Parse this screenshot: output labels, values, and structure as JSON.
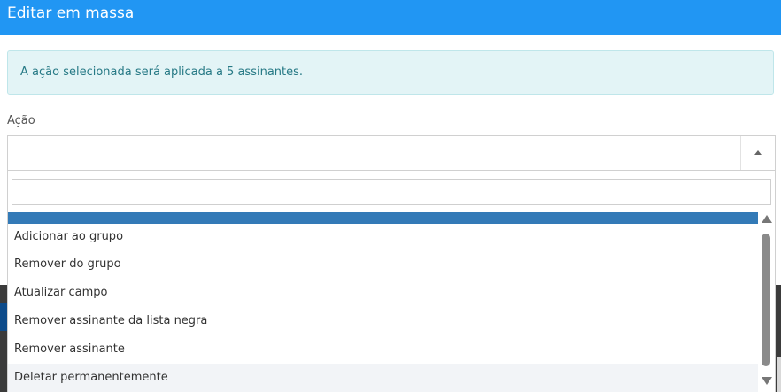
{
  "modal": {
    "title": "Editar em massa",
    "alert_text": "A ação selecionada será aplicada a 5 assinantes."
  },
  "action_field": {
    "label": "Ação",
    "selected_value": "",
    "search_value": "",
    "options": [
      "",
      "Adicionar ao grupo",
      "Remover do grupo",
      "Atualizar campo",
      "Remover assinante da lista negra",
      "Remover assinante",
      "Deletar permanentemente"
    ]
  },
  "colors": {
    "header": "#2196f3",
    "alert_bg": "#e3f4f6",
    "alert_text": "#267985",
    "highlight": "#337ab7"
  }
}
